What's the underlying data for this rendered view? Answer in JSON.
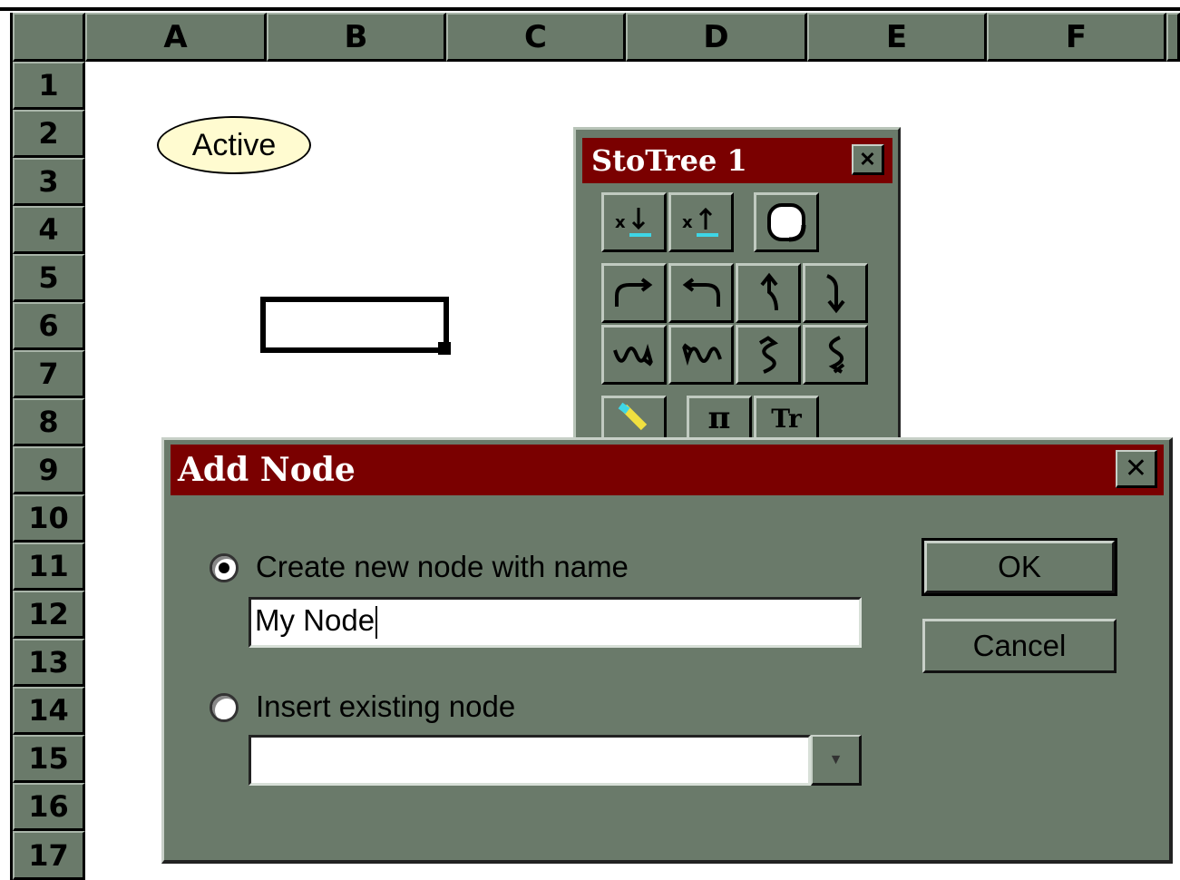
{
  "spreadsheet": {
    "columns": [
      "A",
      "B",
      "C",
      "D",
      "E",
      "F"
    ],
    "rows": [
      "1",
      "2",
      "3",
      "4",
      "5",
      "6",
      "7",
      "8",
      "9",
      "10",
      "11",
      "12",
      "13",
      "14",
      "15",
      "16",
      "17"
    ],
    "shape_label": "Active"
  },
  "palette": {
    "title": "StoTree 1",
    "close_icon": "close-icon",
    "row1": [
      "x↓",
      "x↑",
      "●"
    ],
    "row2": [
      "↷",
      "↶",
      "↑",
      "↓"
    ],
    "row3": [
      "∿",
      "∿",
      "S",
      "S"
    ]
  },
  "dialog": {
    "title": "Add Node",
    "option_new_label": "Create new node with name",
    "name_value": "My Node",
    "option_existing_label": "Insert existing node",
    "existing_value": "",
    "ok_label": "OK",
    "cancel_label": "Cancel",
    "selected_option": "create-new"
  },
  "colors": {
    "title_bar": "#7a0000",
    "face": "#6a7a6a"
  }
}
